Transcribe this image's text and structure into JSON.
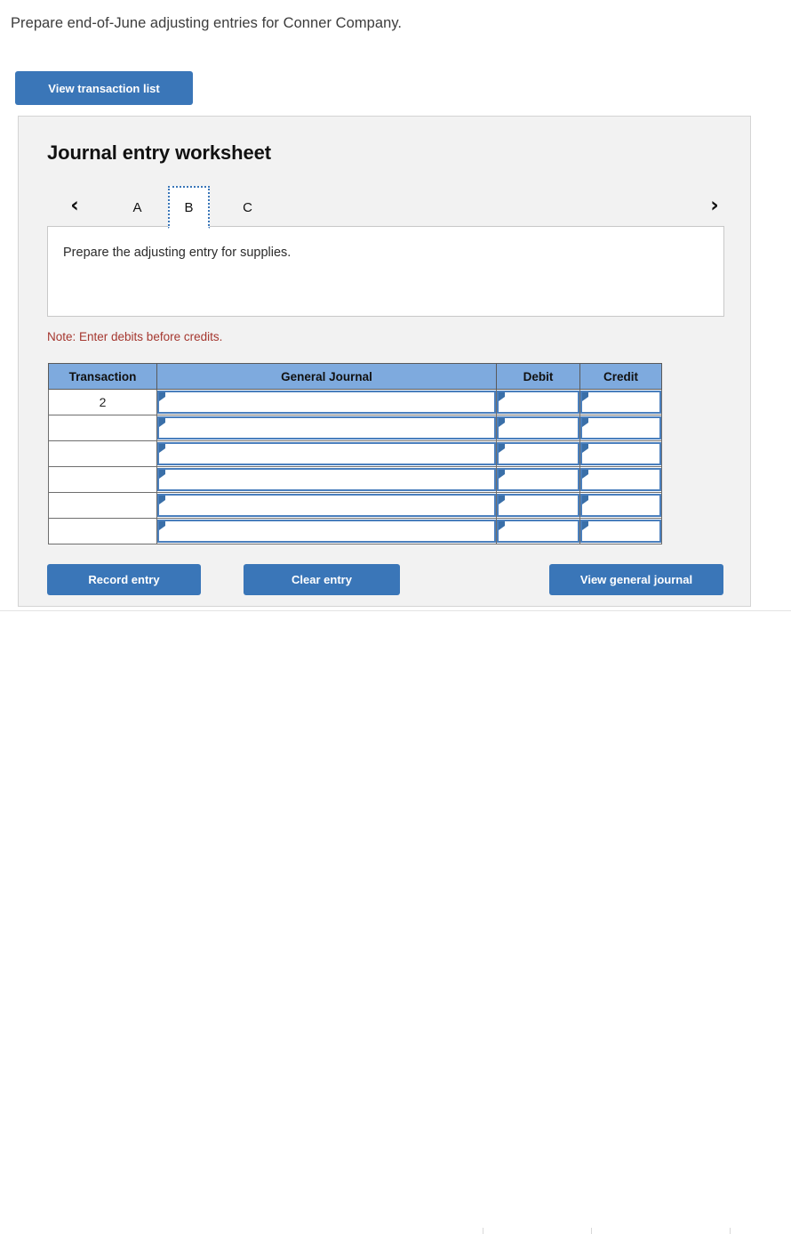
{
  "prompt": "Prepare end-of-June adjusting entries for Conner Company.",
  "toolbar": {
    "view_transaction_list_label": "View transaction list"
  },
  "worksheet": {
    "title": "Journal entry worksheet",
    "nav": {
      "prev_icon": "chevron-left-icon",
      "next_icon": "chevron-right-icon",
      "prev_glyph": "‹",
      "next_glyph": "›"
    },
    "tabs": [
      {
        "label": "A",
        "active": false
      },
      {
        "label": "B",
        "active": true
      },
      {
        "label": "C",
        "active": false
      }
    ],
    "instruction": "Prepare the adjusting entry for supplies.",
    "note": "Note: Enter debits before credits."
  },
  "journal_table": {
    "columns": [
      "Transaction",
      "General Journal",
      "Debit",
      "Credit"
    ],
    "rows": [
      {
        "transaction": "2",
        "general_journal": "",
        "debit": "",
        "credit": ""
      },
      {
        "transaction": "",
        "general_journal": "",
        "debit": "",
        "credit": ""
      },
      {
        "transaction": "",
        "general_journal": "",
        "debit": "",
        "credit": ""
      },
      {
        "transaction": "",
        "general_journal": "",
        "debit": "",
        "credit": ""
      },
      {
        "transaction": "",
        "general_journal": "",
        "debit": "",
        "credit": ""
      },
      {
        "transaction": "",
        "general_journal": "",
        "debit": "",
        "credit": ""
      }
    ]
  },
  "footer": {
    "record_entry_label": "Record entry",
    "clear_entry_label": "Clear entry",
    "view_general_journal_label": "View general journal"
  },
  "colors": {
    "button_blue": "#3a76b8",
    "header_blue": "#7eaade",
    "field_border_blue": "#4a7fbd",
    "note_red": "#a5372f",
    "panel_bg": "#f2f2f2"
  }
}
